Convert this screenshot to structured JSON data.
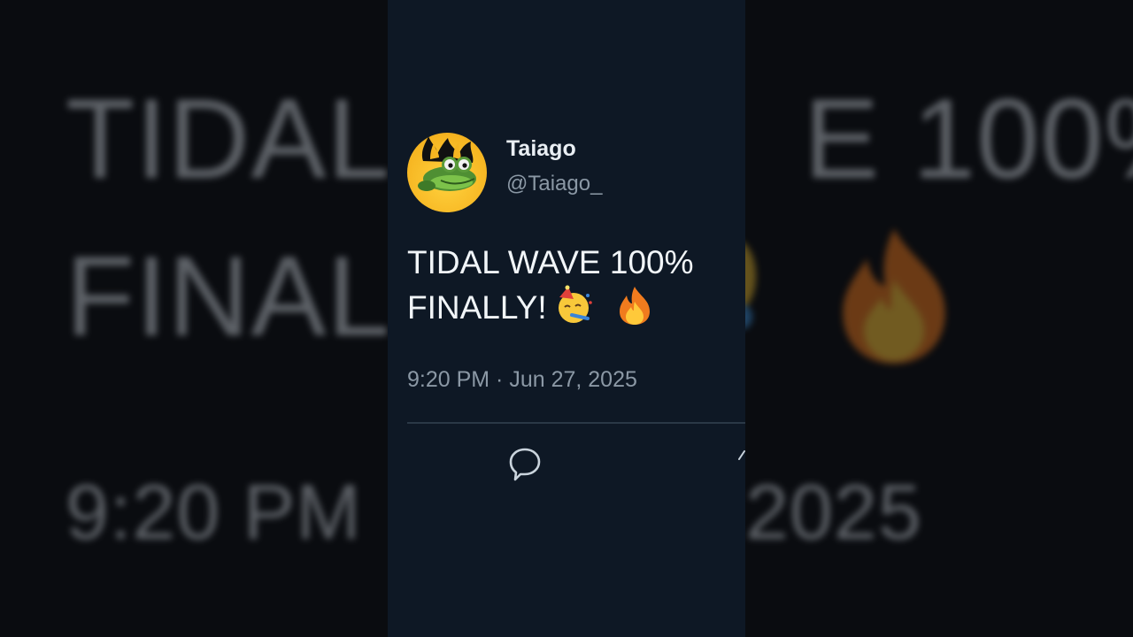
{
  "background": {
    "line1_left": "TIDAL",
    "line1_right": "E 100%",
    "line2_left": "FINAL",
    "time_left": "9:20 PM",
    "year_right": "2025"
  },
  "tweet": {
    "display_name": "Taiago",
    "handle": "@Taiago_",
    "text_line1": "TIDAL WAVE 100%",
    "text_line2": "FINALLY!",
    "emojis": [
      "party-face-icon",
      "fire-icon"
    ],
    "timestamp": "9:20 PM · Jun 27, 2025"
  },
  "actions": {
    "reply_icon": "speech-bubble-icon"
  },
  "colors": {
    "card_bg": "#0e1825",
    "text": "#f1f5f8",
    "muted": "#8b98a5",
    "divider": "#2a3846"
  }
}
